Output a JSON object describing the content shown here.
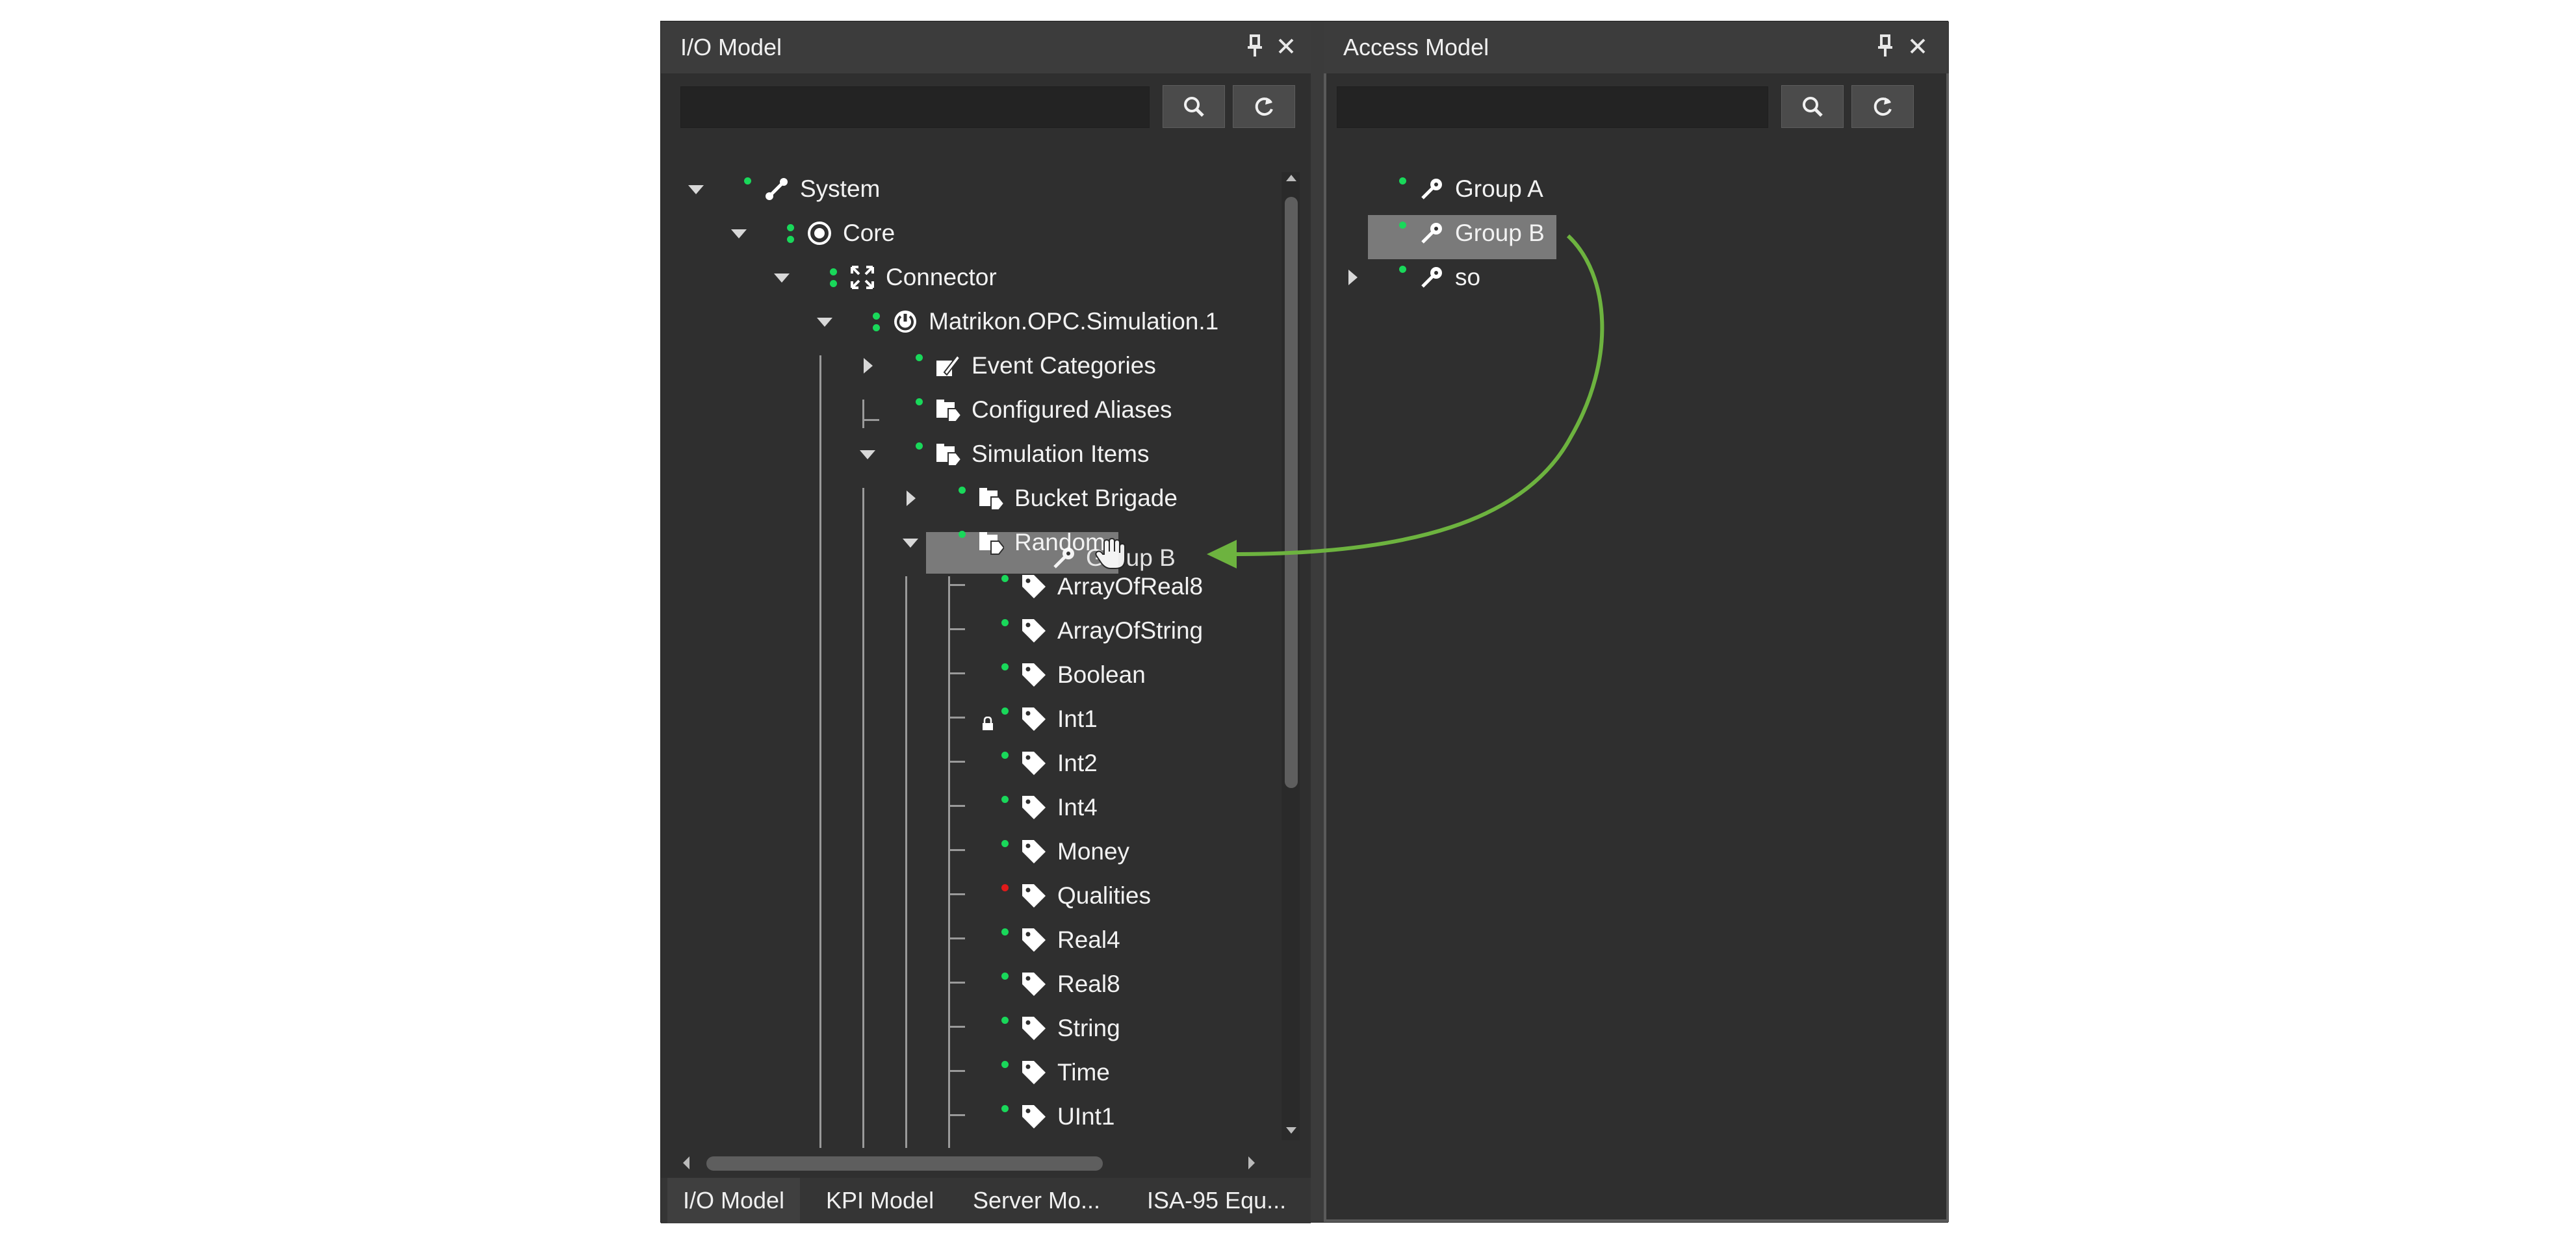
{
  "io_panel": {
    "title": "I/O Model",
    "pin_icon": "pin-icon",
    "close_icon": "close-icon",
    "search": {
      "value": "",
      "placeholder": ""
    },
    "tree": [
      {
        "label": "System",
        "icon": "link-icon"
      },
      {
        "label": "Core",
        "icon": "target-icon"
      },
      {
        "label": "Connector",
        "icon": "expand-arrows-icon"
      },
      {
        "label": "Matrikon.OPC.Simulation.1",
        "icon": "power-icon"
      },
      {
        "label": "Event Categories",
        "icon": "event-folder-icon"
      },
      {
        "label": "Configured Aliases",
        "icon": "tag-folder-icon"
      },
      {
        "label": "Simulation Items",
        "icon": "tag-folder-icon"
      },
      {
        "label": "Bucket Brigade",
        "icon": "tag-folder-icon"
      },
      {
        "label": "Random",
        "icon": "tag-folder-icon"
      },
      {
        "label": "ArrayOfReal8",
        "icon": "tag-icon"
      },
      {
        "label": "ArrayOfString",
        "icon": "tag-icon"
      },
      {
        "label": "Boolean",
        "icon": "tag-icon"
      },
      {
        "label": "Int1",
        "icon": "tag-icon",
        "locked": true
      },
      {
        "label": "Int2",
        "icon": "tag-icon"
      },
      {
        "label": "Int4",
        "icon": "tag-icon"
      },
      {
        "label": "Money",
        "icon": "tag-icon"
      },
      {
        "label": "Qualities",
        "icon": "tag-icon",
        "status": "error"
      },
      {
        "label": "Real4",
        "icon": "tag-icon"
      },
      {
        "label": "Real8",
        "icon": "tag-icon"
      },
      {
        "label": "String",
        "icon": "tag-icon"
      },
      {
        "label": "Time",
        "icon": "tag-icon"
      },
      {
        "label": "UInt1",
        "icon": "tag-icon"
      }
    ],
    "drag_ghost_label": "Group B",
    "tabs": [
      "I/O Model",
      "KPI Model",
      "Server Mo...",
      "ISA-95 Equ..."
    ],
    "active_tab": "I/O Model"
  },
  "access_panel": {
    "title": "Access Model",
    "pin_icon": "pin-icon",
    "close_icon": "close-icon",
    "search": {
      "value": "",
      "placeholder": ""
    },
    "tree": [
      {
        "label": "Group A",
        "icon": "key-icon"
      },
      {
        "label": "Group B",
        "icon": "key-icon",
        "selected": true
      },
      {
        "label": "so",
        "icon": "key-icon"
      }
    ]
  },
  "colors": {
    "status_ok": "#19d85a",
    "status_error": "#e01a1a",
    "drag_arrow": "#6db33f",
    "selection": "#7a7a7a"
  }
}
